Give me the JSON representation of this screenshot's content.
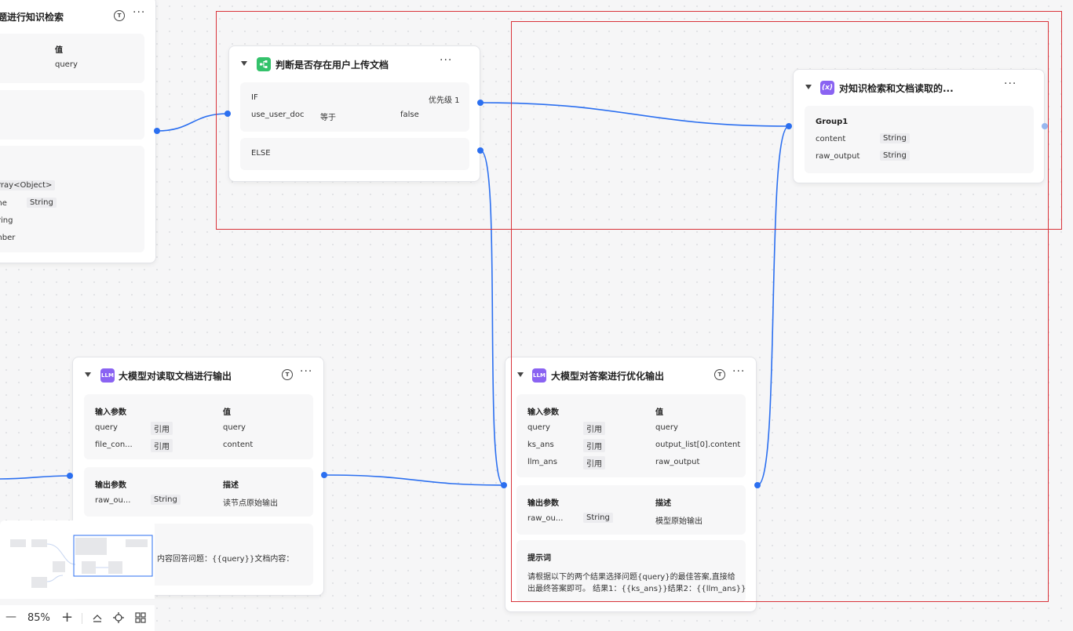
{
  "node_left": {
    "title": "题进行知识检索",
    "col_value": "值",
    "r1_value": "query",
    "out1_type": "rray<Object>",
    "out2_name": "me",
    "out2_type": "String",
    "out3_type": "tring",
    "out4_type": "mber"
  },
  "node_condition": {
    "title": "判断是否存在用户上传文档",
    "if_label": "IF",
    "priority": "优先级 1",
    "cond_var": "use_user_doc",
    "cond_op": "等于",
    "cond_val": "false",
    "else_label": "ELSE"
  },
  "node_aggregate": {
    "title": "对知识检索和文档读取的...",
    "group": "Group1",
    "rows": [
      {
        "name": "content",
        "type": "String"
      },
      {
        "name": "raw_output",
        "type": "String"
      }
    ]
  },
  "node_llm_doc": {
    "title": "大模型对读取文档进行输出",
    "icon_text": "LLM",
    "in_header": "输入参数",
    "val_header": "值",
    "inputs": [
      {
        "name": "query",
        "ref": "引用",
        "value": "query"
      },
      {
        "name": "file_con...",
        "ref": "引用",
        "value": "content"
      }
    ],
    "out_header": "输出参数",
    "desc_header": "描述",
    "output": {
      "name": "raw_ou...",
      "type": "String",
      "desc": "读节点原始输出"
    },
    "prompt_partial": "内容回答问题：{{query}}文档内容："
  },
  "node_llm_opt": {
    "title": "大模型对答案进行优化输出",
    "icon_text": "LLM",
    "in_header": "输入参数",
    "val_header": "值",
    "inputs": [
      {
        "name": "query",
        "ref": "引用",
        "value": "query"
      },
      {
        "name": "ks_ans",
        "ref": "引用",
        "value": "output_list[0].content"
      },
      {
        "name": "llm_ans",
        "ref": "引用",
        "value": "raw_output"
      }
    ],
    "out_header": "输出参数",
    "desc_header": "描述",
    "output": {
      "name": "raw_ou...",
      "type": "String",
      "desc": "模型原始输出"
    },
    "prompt_header": "提示词",
    "prompt_line1": "请根据以下的两个结果选择问题{query}的最佳答案,直接给",
    "prompt_line2": "出最终答案即可。 结果1：{{ks_ans}}结果2：{{llm_ans}}"
  },
  "toolbar": {
    "zoom": "85%",
    "minus": "—",
    "plus": "+"
  },
  "colors": {
    "wire": "#2b6ff0",
    "selection": "#d9333a",
    "condition_icon": "#34c26b",
    "llm_icon": "#8a63f2"
  }
}
